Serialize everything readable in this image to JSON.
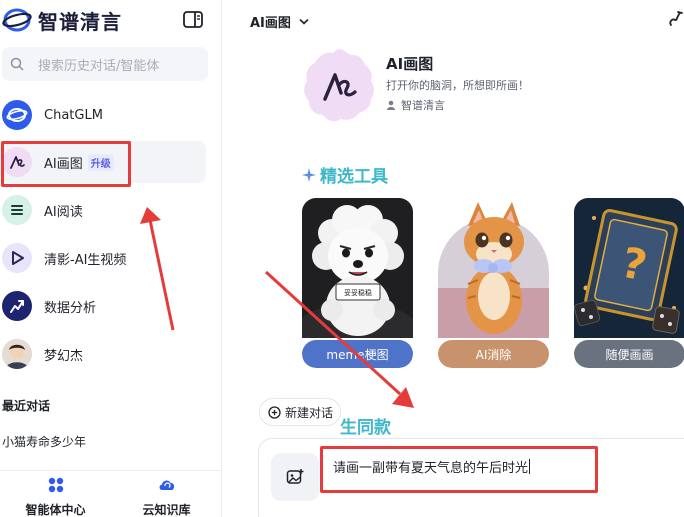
{
  "brand": {
    "name": "智谱清言"
  },
  "search": {
    "placeholder": "搜索历史对话/智能体"
  },
  "sidebar": {
    "items": [
      {
        "label": "ChatGLM",
        "icon": "chatglm-logo-icon"
      },
      {
        "label": "AI画图",
        "badge": "升级",
        "icon": "ai-drawing-icon"
      },
      {
        "label": "AI阅读",
        "icon": "ai-reading-icon"
      },
      {
        "label": "清影-AI生视频",
        "icon": "video-play-icon"
      },
      {
        "label": "数据分析",
        "icon": "chart-icon"
      },
      {
        "label": "梦幻杰",
        "icon": "user-avatar-icon"
      }
    ],
    "recent_title": "最近对话",
    "recent": [
      "小猫寿命多少年"
    ],
    "bottom": [
      {
        "label": "智能体中心",
        "icon": "apps-grid-icon"
      },
      {
        "label": "云知识库",
        "icon": "cloud-sync-icon"
      }
    ]
  },
  "main": {
    "title": "AI画图",
    "agent": {
      "name": "AI画图",
      "description": "打开你的脑洞，所想即所画！",
      "author": "智谱清言"
    },
    "tools_title": "精选工具",
    "tools": [
      {
        "label": "meme梗图",
        "image": "white-fluffy-dog",
        "sign_text": "妥妥稳稳",
        "color": "#4f73c9"
      },
      {
        "label": "AI消除",
        "image": "orange-kitten",
        "color": "#c8926c"
      },
      {
        "label": "随便画画",
        "image": "mystery-card",
        "color": "#6a7280"
      }
    ],
    "same_style_title": "生同款",
    "new_chat_label": "新建对话",
    "composer": {
      "text": "请画一副带有夏天气息的午后时光"
    }
  },
  "colors": {
    "accent": "#3fb8c9",
    "annotation": "#e63b3b",
    "brand": "#2f5bea"
  }
}
